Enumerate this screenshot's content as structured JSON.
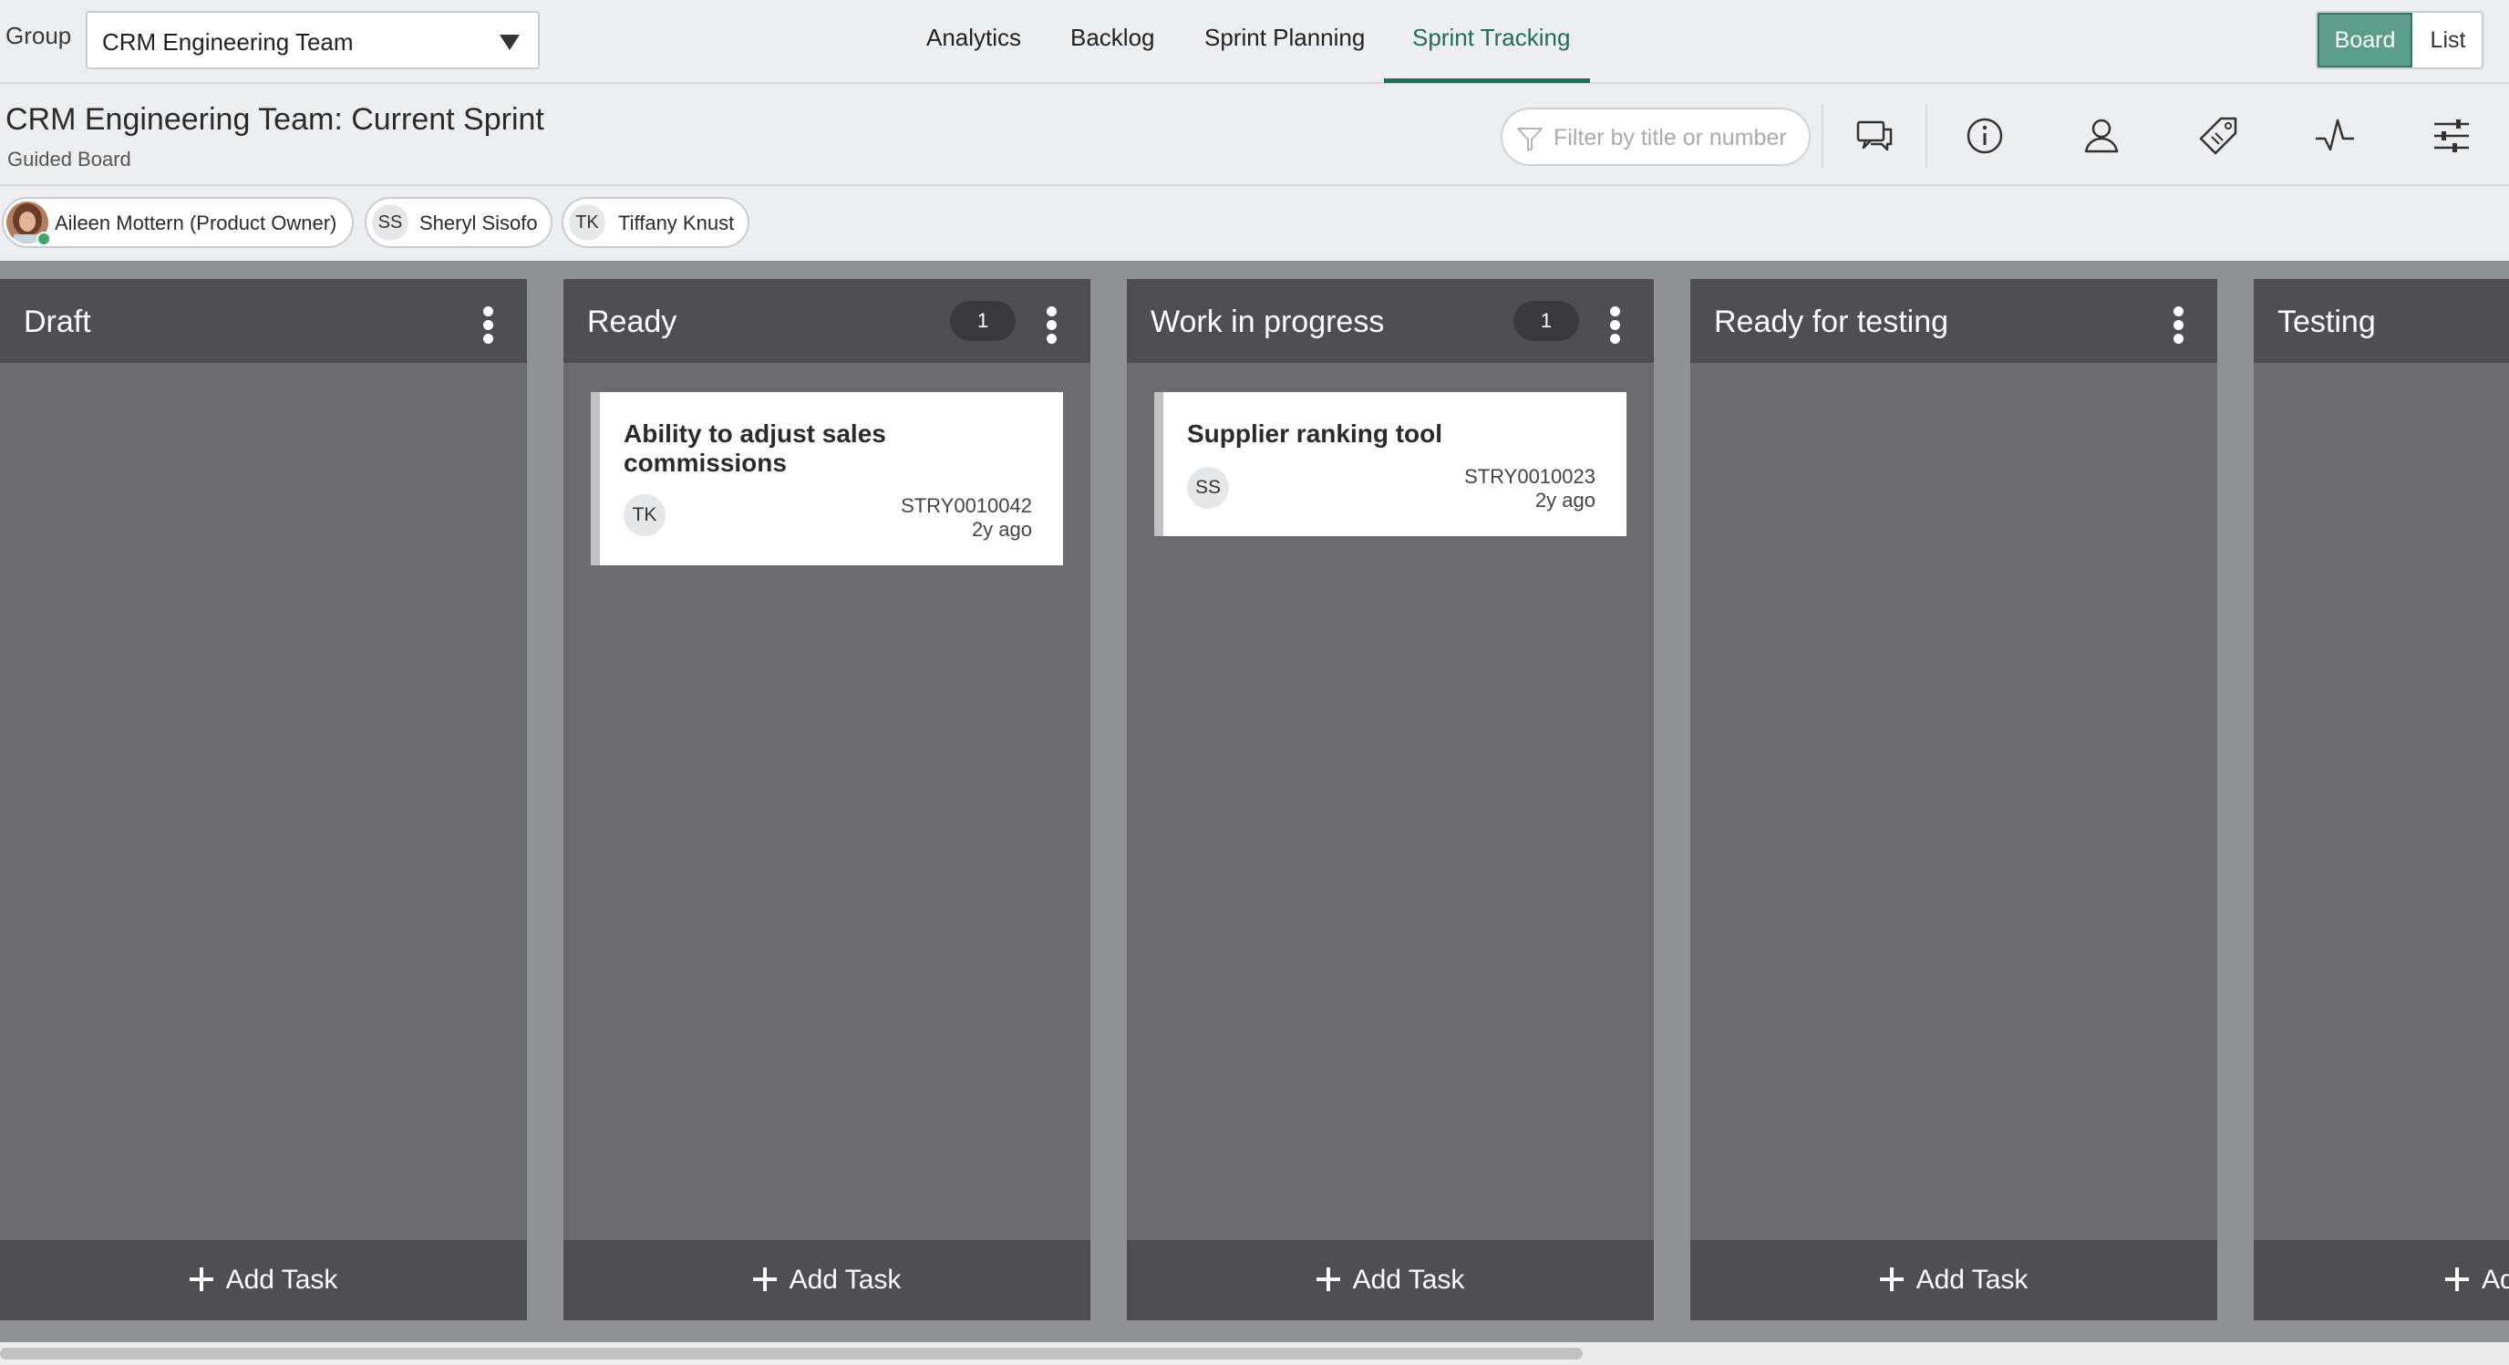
{
  "topbar": {
    "group_label": "Group",
    "group_value": "CRM Engineering Team",
    "tabs": [
      {
        "label": "Analytics"
      },
      {
        "label": "Backlog"
      },
      {
        "label": "Sprint Planning"
      },
      {
        "label": "Sprint Tracking",
        "active": true
      }
    ],
    "view_board": "Board",
    "view_list": "List"
  },
  "titlebar": {
    "title": "CRM Engineering Team: Current Sprint",
    "subtitle": "Guided Board",
    "filter_placeholder": "Filter by title or number",
    "icons": [
      "comments-icon",
      "info-icon",
      "user-icon",
      "tag-icon",
      "activity-icon",
      "sliders-icon"
    ]
  },
  "members": [
    {
      "name": "Aileen Mottern (Product Owner)",
      "initials": "",
      "photo": true,
      "online": true
    },
    {
      "name": "Sheryl Sisofo",
      "initials": "SS"
    },
    {
      "name": "Tiffany Knust",
      "initials": "TK"
    }
  ],
  "columns": [
    {
      "title": "Draft",
      "count": "",
      "cards": [],
      "add_label": "Add Task"
    },
    {
      "title": "Ready",
      "count": "1",
      "cards": [
        {
          "title": "Ability to adjust sales commissions",
          "initials": "TK",
          "number": "STRY0010042",
          "time": "2y ago"
        }
      ],
      "add_label": "Add Task"
    },
    {
      "title": "Work in progress",
      "count": "1",
      "cards": [
        {
          "title": "Supplier ranking tool",
          "initials": "SS",
          "number": "STRY0010023",
          "time": "2y ago"
        }
      ],
      "add_label": "Add Task"
    },
    {
      "title": "Ready for testing",
      "count": "",
      "cards": [],
      "add_label": "Add Task"
    },
    {
      "title": "Testing",
      "count": "",
      "cards": [],
      "add_label": "Add Task"
    }
  ],
  "colors": {
    "accent": "#1f6d5a",
    "board_toggle": "#5b9f8b",
    "column_bg": "#6b6b70",
    "column_header": "#4e4e53",
    "board_bg": "#8f9194"
  }
}
